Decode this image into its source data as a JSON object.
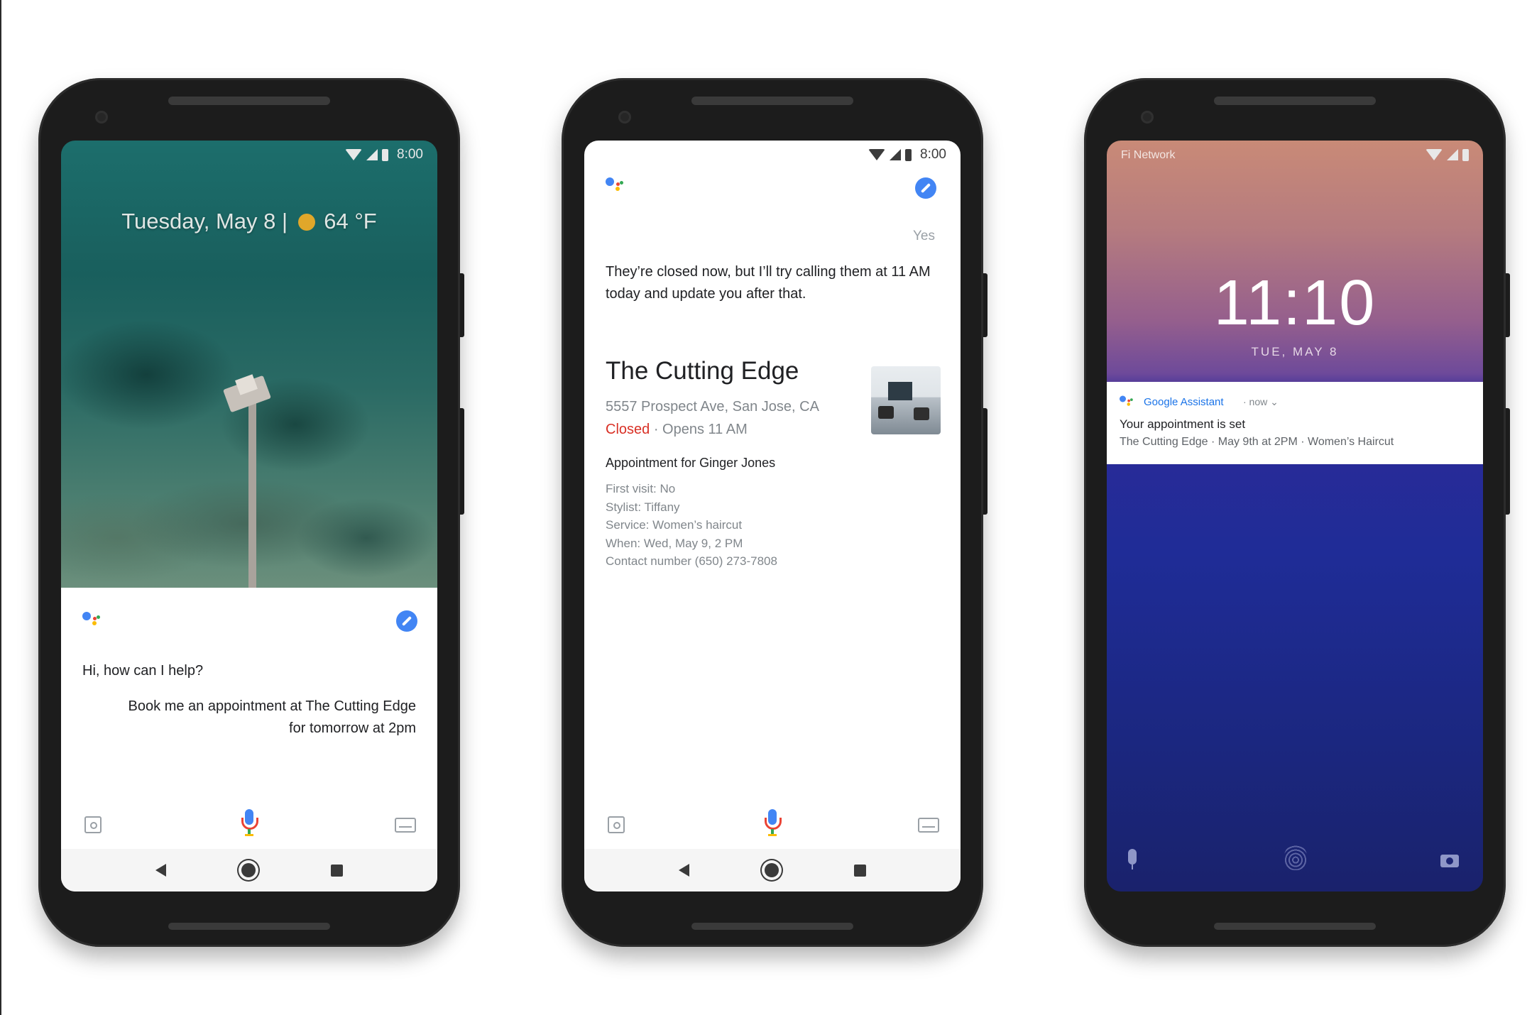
{
  "phone1": {
    "status_time": "8:00",
    "lock_date": "Tuesday, May 8 |",
    "lock_temp": "64 °F",
    "assistant_prompt": "Hi, how can I help?",
    "user_line1": "Book me an appointment at The Cutting Edge",
    "user_line2": "for tomorrow at 2pm"
  },
  "phone2": {
    "status_time": "8:00",
    "user_reply": "Yes",
    "assistant_reply": "They’re closed now, but I’ll try calling them at 11 AM today and update you after that.",
    "business": {
      "name": "The Cutting Edge",
      "address": "5557 Prospect Ave, San Jose, CA",
      "status_closed": "Closed",
      "status_opens": " · Opens 11 AM"
    },
    "appointment": {
      "heading": "Appointment for Ginger Jones",
      "lines": [
        "First visit: No",
        "Stylist: Tiffany",
        "Service: Women’s haircut",
        "When: Wed, May 9, 2 PM",
        "Contact number (650) 273-7808"
      ]
    }
  },
  "phone3": {
    "carrier": "Fi Network",
    "clock": "11:10",
    "date": "TUE, MAY 8",
    "notification": {
      "app": "Google Assistant",
      "meta": "· now ⌄",
      "title": "Your appointment is set",
      "body": "The Cutting Edge · May 9th at 2PM · Women’s Haircut"
    }
  },
  "colors": {
    "google_blue": "#4285f4",
    "google_red": "#ea4335",
    "google_yellow": "#fbbc05",
    "google_green": "#34a853",
    "closed_red": "#d93025"
  },
  "icons": [
    "wifi-icon",
    "cell-signal-icon",
    "battery-icon",
    "assistant-logo-icon",
    "compass-icon",
    "lens-icon",
    "mic-icon",
    "keyboard-icon",
    "back-icon",
    "home-icon",
    "recents-icon",
    "sun-icon",
    "fingerprint-icon",
    "camera-icon"
  ]
}
